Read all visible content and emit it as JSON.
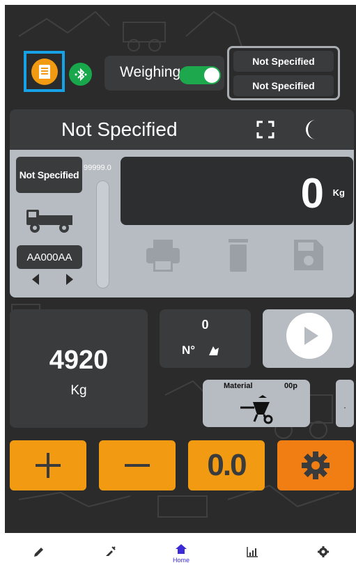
{
  "topbar": {
    "report_icon": "report-icon",
    "bluetooth_icon": "bluetooth-icon",
    "weighing_label": "Weighing",
    "weighing_enabled": true,
    "spec_top": "Not Specified",
    "spec_bottom": "Not Specified"
  },
  "panel": {
    "title": "Not Specified",
    "selector_label": "Not Specified",
    "max_value": "99999.0",
    "plate": "AA000AA",
    "reading_value": "0",
    "reading_unit": "Kg",
    "icons": [
      "fullscreen-icon",
      "moon-icon",
      "truck-icon",
      "print-icon",
      "trash-icon",
      "save-icon"
    ]
  },
  "stats": {
    "weight_value": "4920",
    "weight_unit": "Kg",
    "count_value": "0",
    "count_label": "N°",
    "material_label": "Material",
    "material_code": "00p",
    "side_tab": "."
  },
  "actions": {
    "zero_label": "0.0",
    "icons": [
      "plus-icon",
      "minus-icon",
      "gear-icon",
      "play-icon"
    ]
  },
  "nav": {
    "items": [
      {
        "icon": "pencil-icon",
        "label": ""
      },
      {
        "icon": "syringe-icon",
        "label": ""
      },
      {
        "icon": "home-icon",
        "label": "Home",
        "active": true
      },
      {
        "icon": "chart-icon",
        "label": ""
      },
      {
        "icon": "settings-icon",
        "label": ""
      }
    ]
  },
  "colors": {
    "background": "#2b2b2b",
    "orange": "#f19a12",
    "dark_orange": "#f07e12",
    "green": "#19a74b",
    "highlight": "#17a2e8",
    "panel_light": "#b7bcc2",
    "nav_active": "#3c2ad6"
  }
}
